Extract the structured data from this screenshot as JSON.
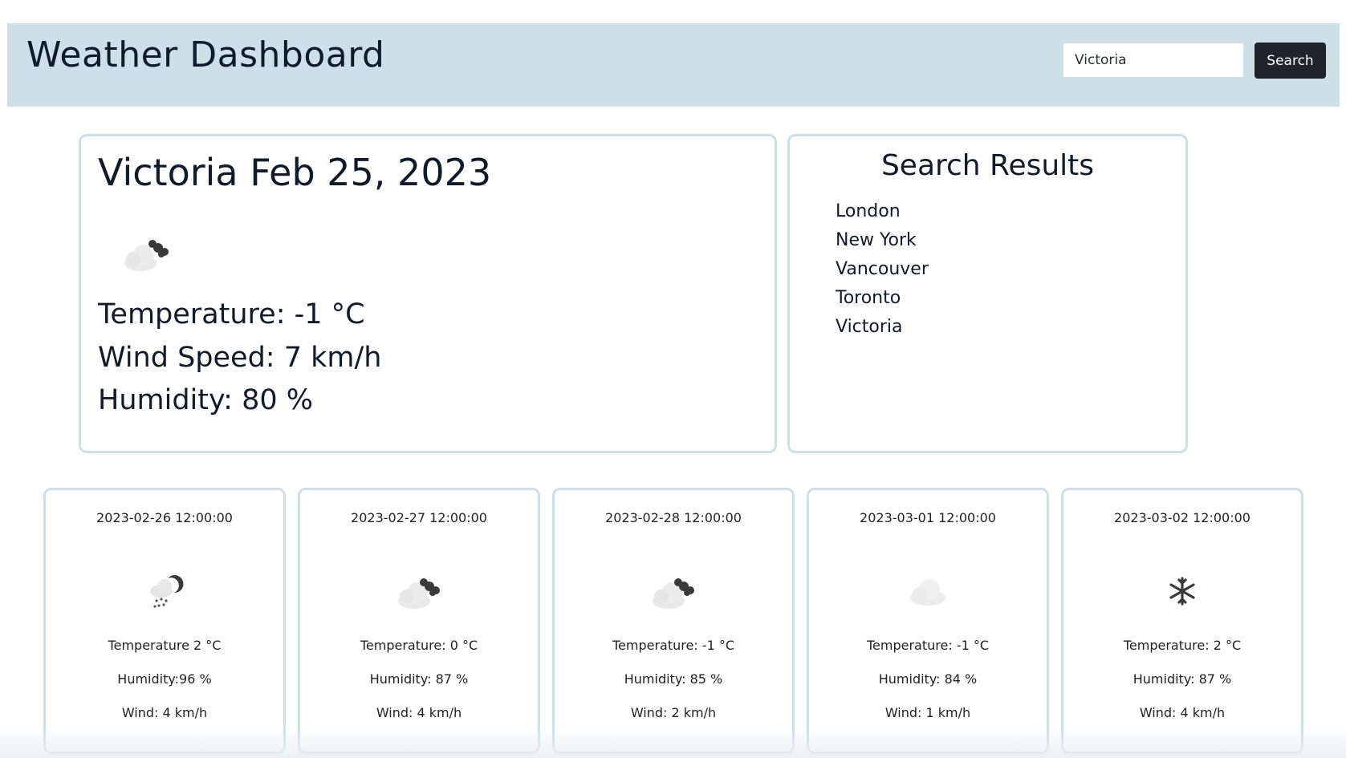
{
  "header": {
    "title": "Weather Dashboard",
    "search_value": "Victoria",
    "search_button": "Search"
  },
  "current": {
    "heading": "Victoria Feb 25, 2023",
    "icon": "cloud-icon",
    "temperature": "Temperature: -1 °C",
    "wind": "Wind Speed: 7 km/h",
    "humidity": "Humidity: 80 %"
  },
  "results": {
    "title": "Search Results",
    "items": [
      "London",
      "New York",
      "Vancouver",
      "Toronto",
      "Victoria"
    ]
  },
  "forecast": [
    {
      "date": "2023-02-26 12:00:00",
      "icon": "snow-cloud-icon",
      "temperature": "Temperature 2 °C",
      "humidity": "Humidity:96 %",
      "wind": "Wind: 4 km/h"
    },
    {
      "date": "2023-02-27 12:00:00",
      "icon": "cloud-icon",
      "temperature": "Temperature: 0 °C",
      "humidity": "Humidity: 87 %",
      "wind": "Wind: 4 km/h"
    },
    {
      "date": "2023-02-28 12:00:00",
      "icon": "cloud-icon",
      "temperature": "Temperature: -1 °C",
      "humidity": "Humidity: 85 %",
      "wind": "Wind: 2 km/h"
    },
    {
      "date": "2023-03-01 12:00:00",
      "icon": "light-cloud-icon",
      "temperature": "Temperature: -1 °C",
      "humidity": "Humidity: 84 %",
      "wind": "Wind: 1 km/h"
    },
    {
      "date": "2023-03-02 12:00:00",
      "icon": "snowflake-icon",
      "temperature": "Temperature: 2 °C",
      "humidity": "Humidity: 87 %",
      "wind": "Wind: 4 km/h"
    }
  ]
}
